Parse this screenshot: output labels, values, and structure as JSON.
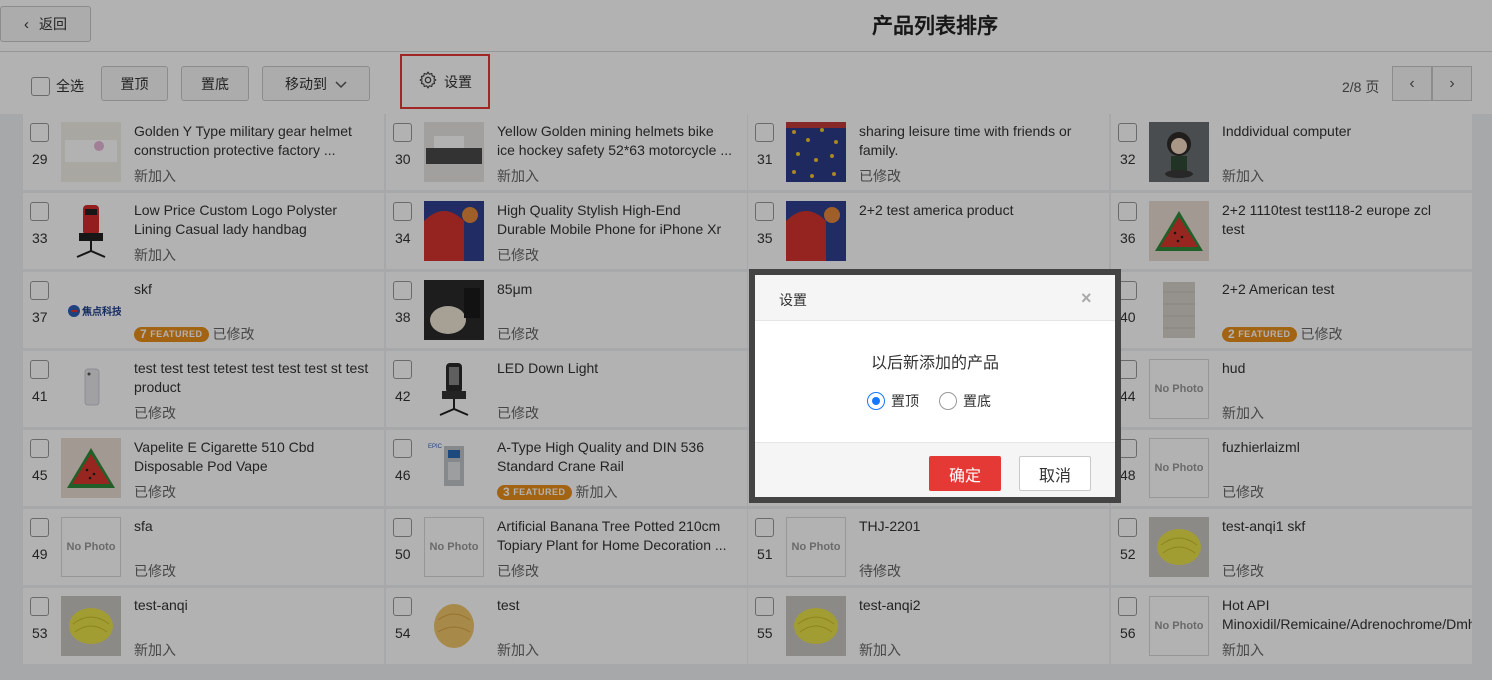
{
  "header": {
    "back_label": "返回",
    "title": "产品列表排序"
  },
  "toolbar": {
    "select_all_label": "全选",
    "top_label": "置顶",
    "bottom_label": "置底",
    "move_to_label": "移动到",
    "settings_label": "设置",
    "page_info": "2/8 页"
  },
  "products": [
    {
      "num": "29",
      "name": "Golden Y Type military gear helmet construction protective factory ...",
      "status": "新加入",
      "image": "helmet-white"
    },
    {
      "num": "30",
      "name": "Yellow Golden mining helmets bike ice hockey safety 52*63 motorcycle ...",
      "status": "新加入",
      "image": "helmet-dark"
    },
    {
      "num": "31",
      "name": "sharing leisure time with friends or family.",
      "status": "已修改",
      "image": "fabric-blue"
    },
    {
      "num": "32",
      "name": "Inddividual computer",
      "status": "新加入",
      "image": "figurine"
    },
    {
      "num": "33",
      "name": "Low Price Custom Logo Polyster Lining Casual lady handbag",
      "status": "新加入",
      "image": "gaming-chair-red"
    },
    {
      "num": "34",
      "name": "High Quality Stylish High-End Durable Mobile Phone for iPhone Xr Xr Xs M...",
      "status": "已修改",
      "image": "abstract-red"
    },
    {
      "num": "35",
      "name": "2+2 test america product",
      "status": "",
      "image": "abstract-red"
    },
    {
      "num": "36",
      "name": "2+2 1110test test118-2 europe zcl test",
      "status": "",
      "image": "watermelon"
    },
    {
      "num": "37",
      "name": "skf",
      "status": "已修改",
      "image": "logo-jiaodian",
      "featured": "FEATURED",
      "featured_num": "7"
    },
    {
      "num": "38",
      "name": "85μm",
      "status": "已修改",
      "image": "car-seat"
    },
    {
      "num": "40",
      "name": "2+2 American test",
      "status": "已修改",
      "image": "gray-panel",
      "featured": "FEATURED",
      "featured_num": "2"
    },
    {
      "num": "41",
      "name": "test test test tetest test test test st test product",
      "status": "已修改",
      "image": "phone-white"
    },
    {
      "num": "42",
      "name": "LED Down Light",
      "status": "已修改",
      "image": "gaming-chair-black"
    },
    {
      "num": "44",
      "name": "hud",
      "status": "新加入",
      "image": "no-photo"
    },
    {
      "num": "45",
      "name": "Vapelite E Cigarette 510 Cbd Disposable Pod Vape",
      "status": "已修改",
      "image": "watermelon"
    },
    {
      "num": "46",
      "name": "A-Type High Quality and DIN 536 Standard Crane Rail",
      "status": "新加入",
      "image": "machine",
      "featured": "FEATURED",
      "featured_num": "3"
    },
    {
      "num": "48",
      "name": "fuzhierlaizml",
      "status": "已修改",
      "image": "no-photo"
    },
    {
      "num": "49",
      "name": "sfa",
      "status": "已修改",
      "image": "no-photo"
    },
    {
      "num": "50",
      "name": "Artificial Banana Tree Potted 210cm Topiary Plant for Home Decoration ...",
      "status": "已修改",
      "image": "no-photo"
    },
    {
      "num": "51",
      "name": "THJ-2201",
      "status": "待修改",
      "image": "no-photo"
    },
    {
      "num": "52",
      "name": "test-anqi1 skf",
      "status": "已修改",
      "image": "yarn-yellow"
    },
    {
      "num": "53",
      "name": "test-anqi",
      "status": "新加入",
      "image": "yarn-yellow"
    },
    {
      "num": "54",
      "name": "test",
      "status": "新加入",
      "image": "yarn-orange"
    },
    {
      "num": "55",
      "name": "test-anqi2",
      "status": "新加入",
      "image": "yarn-yellow"
    },
    {
      "num": "56",
      "name": "Hot API Minoxidil/Remicaine/Adrenochrome/Dmha",
      "status": "新加入",
      "image": "no-photo"
    }
  ],
  "no_photo_label": "No Photo",
  "modal": {
    "title": "设置",
    "close": "×",
    "text": "以后新添加的产品",
    "option_top": "置顶",
    "option_bottom": "置底",
    "selected": "top",
    "ok_label": "确定",
    "cancel_label": "取消"
  },
  "colors": {
    "accent_red": "#e53935",
    "radio_blue": "#1677ff",
    "featured_orange": "#e88f1a"
  }
}
